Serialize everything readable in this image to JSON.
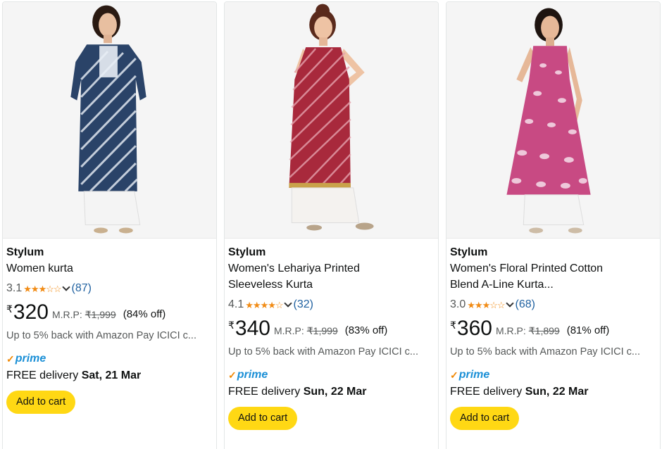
{
  "products": [
    {
      "brand": "Stylum",
      "title": "Women kurta",
      "title_line2": "",
      "rating": "3.1",
      "stars_full": 3,
      "review_count": "(87)",
      "currency": "₹",
      "price": "320",
      "mrp_label": "M.R.P:",
      "mrp": "₹1,999",
      "discount": "(84% off)",
      "cashback": "Up to 5% back with Amazon Pay ICICI c...",
      "prime_label": "prime",
      "delivery_label": "FREE delivery",
      "delivery_date": "Sat, 21 Mar",
      "cart_label": "Add to cart",
      "image": "woman-in-navy-leheriya-kurta"
    },
    {
      "brand": "Stylum",
      "title": "Women's Lehariya Printed",
      "title_line2": "Sleeveless Kurta",
      "rating": "4.1",
      "stars_full": 4,
      "review_count": "(32)",
      "currency": "₹",
      "price": "340",
      "mrp_label": "M.R.P:",
      "mrp": "₹1,999",
      "discount": "(83% off)",
      "cashback": "Up to 5% back with Amazon Pay ICICI c...",
      "prime_label": "prime",
      "delivery_label": "FREE delivery",
      "delivery_date": "Sun, 22 Mar",
      "cart_label": "Add to cart",
      "image": "woman-in-red-sleeveless-kurta"
    },
    {
      "brand": "Stylum",
      "title": "Women's Floral Printed Cotton",
      "title_line2": "Blend A-Line Kurta...",
      "rating": "3.0",
      "stars_full": 3,
      "review_count": "(68)",
      "currency": "₹",
      "price": "360",
      "mrp_label": "M.R.P:",
      "mrp": "₹1,899",
      "discount": "(81% off)",
      "cashback": "Up to 5% back with Amazon Pay ICICI c...",
      "prime_label": "prime",
      "delivery_label": "FREE delivery",
      "delivery_date": "Sun, 22 Mar",
      "cart_label": "Add to cart",
      "image": "woman-in-pink-floral-kurta"
    }
  ],
  "colors": {
    "star": "#f18b14",
    "link": "#2162a1",
    "prime": "#1a8fd6",
    "cart_button": "#ffd814"
  }
}
